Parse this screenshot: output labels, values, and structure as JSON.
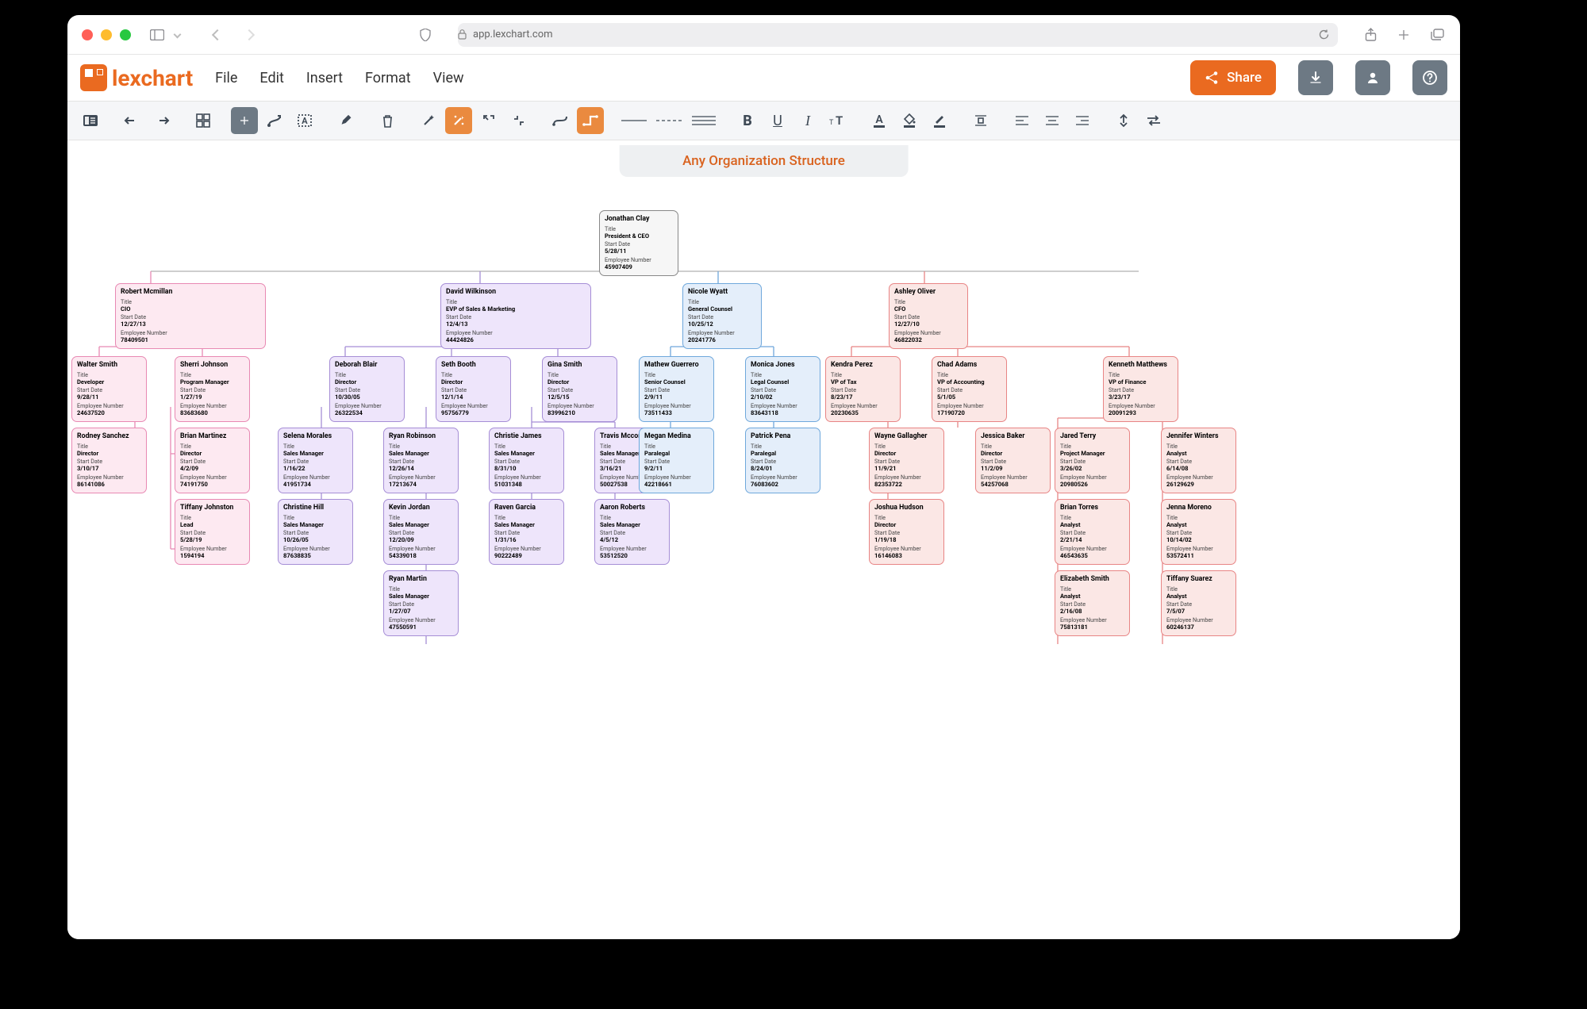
{
  "browser": {
    "url_host": "app.lexchart.com"
  },
  "brand": {
    "name": "lexchart"
  },
  "menu": {
    "file": "File",
    "edit": "Edit",
    "insert": "Insert",
    "format": "Format",
    "view": "View"
  },
  "header_buttons": {
    "share": "Share"
  },
  "chart_title": "Any Organization Structure",
  "field_labels": {
    "title": "Title",
    "start": "Start Date",
    "emp": "Employee Number"
  },
  "nodes": {
    "root": {
      "name": "Jonathan Clay",
      "title": "President & CEO",
      "start": "5/28/11",
      "emp": "45907409"
    },
    "l1a": {
      "name": "Robert Mcmillan",
      "title": "CIO",
      "start": "12/27/13",
      "emp": "78409501"
    },
    "l1b": {
      "name": "David Wilkinson",
      "title": "EVP of Sales & Marketing",
      "start": "12/4/13",
      "emp": "44424826"
    },
    "l1c": {
      "name": "Nicole Wyatt",
      "title": "General Counsel",
      "start": "10/25/12",
      "emp": "20241776"
    },
    "l1d": {
      "name": "Ashley Oliver",
      "title": "CFO",
      "start": "12/27/10",
      "emp": "46822032"
    },
    "a1": {
      "name": "Walter Smith",
      "title": "Developer",
      "start": "9/28/11",
      "emp": "24637520"
    },
    "a2": {
      "name": "Sherri Johnson",
      "title": "Program Manager",
      "start": "1/27/19",
      "emp": "83683680"
    },
    "a3": {
      "name": "Rodney Sanchez",
      "title": "Director",
      "start": "3/10/17",
      "emp": "86141086"
    },
    "a4": {
      "name": "Brian Martinez",
      "title": "Director",
      "start": "4/2/09",
      "emp": "74191750"
    },
    "a5": {
      "name": "Tiffany Johnston",
      "title": "Lead",
      "start": "5/28/19",
      "emp": "1594194"
    },
    "b1": {
      "name": "Deborah Blair",
      "title": "Director",
      "start": "10/30/05",
      "emp": "26322534"
    },
    "b2": {
      "name": "Seth Booth",
      "title": "Director",
      "start": "12/1/14",
      "emp": "95756779"
    },
    "b3": {
      "name": "Gina Smith",
      "title": "Director",
      "start": "12/5/15",
      "emp": "83996210"
    },
    "b1a": {
      "name": "Selena Morales",
      "title": "Sales Manager",
      "start": "1/16/22",
      "emp": "41951734"
    },
    "b1b": {
      "name": "Christine Hill",
      "title": "Sales Manager",
      "start": "10/26/05",
      "emp": "87638835"
    },
    "b2a": {
      "name": "Ryan Robinson",
      "title": "Sales Manager",
      "start": "12/26/14",
      "emp": "17213674"
    },
    "b2b": {
      "name": "Kevin Jordan",
      "title": "Sales Manager",
      "start": "12/20/09",
      "emp": "54339018"
    },
    "b2c": {
      "name": "Ryan Martin",
      "title": "Sales Manager",
      "start": "1/27/07",
      "emp": "47550591"
    },
    "b3a": {
      "name": "Christie James",
      "title": "Sales Manager",
      "start": "8/31/10",
      "emp": "51031348"
    },
    "b3b": {
      "name": "Raven Garcia",
      "title": "Sales Manager",
      "start": "1/31/16",
      "emp": "90222489"
    },
    "b3c": {
      "name": "Travis Mccormick",
      "title": "Sales Manager",
      "start": "3/16/21",
      "emp": "50027538"
    },
    "b3d": {
      "name": "Aaron Roberts",
      "title": "Sales Manager",
      "start": "4/5/12",
      "emp": "53512520"
    },
    "c1": {
      "name": "Mathew Guerrero",
      "title": "Senior Counsel",
      "start": "2/9/11",
      "emp": "73511433"
    },
    "c2": {
      "name": "Monica Jones",
      "title": "Legal Counsel",
      "start": "2/10/02",
      "emp": "83643118"
    },
    "c1a": {
      "name": "Megan Medina",
      "title": "Paralegal",
      "start": "9/2/11",
      "emp": "42218661"
    },
    "c2a": {
      "name": "Patrick Pena",
      "title": "Paralegal",
      "start": "8/24/01",
      "emp": "76083602"
    },
    "d1": {
      "name": "Kendra Perez",
      "title": "VP of Tax",
      "start": "8/23/17",
      "emp": "20230635"
    },
    "d2": {
      "name": "Chad Adams",
      "title": "VP of Accounting",
      "start": "5/1/05",
      "emp": "17190720"
    },
    "d3": {
      "name": "Kenneth Matthews",
      "title": "VP of Finance",
      "start": "3/23/17",
      "emp": "20091293"
    },
    "d1a": {
      "name": "Wayne Gallagher",
      "title": "Director",
      "start": "11/9/21",
      "emp": "82353722"
    },
    "d1b": {
      "name": "Joshua Hudson",
      "title": "Director",
      "start": "1/19/18",
      "emp": "16146083"
    },
    "d2a": {
      "name": "Jessica Baker",
      "title": "Director",
      "start": "11/2/09",
      "emp": "54257068"
    },
    "d3a": {
      "name": "Jared Terry",
      "title": "Project Manager",
      "start": "3/26/02",
      "emp": "20980526"
    },
    "d3b": {
      "name": "Brian Torres",
      "title": "Analyst",
      "start": "2/21/14",
      "emp": "46543635"
    },
    "d3c": {
      "name": "Elizabeth Smith",
      "title": "Analyst",
      "start": "2/16/08",
      "emp": "75813181"
    },
    "d3d": {
      "name": "Jennifer Winters",
      "title": "Analyst",
      "start": "6/14/08",
      "emp": "26129629"
    },
    "d3e": {
      "name": "Jenna Moreno",
      "title": "Analyst",
      "start": "10/14/02",
      "emp": "53572411"
    },
    "d3f": {
      "name": "Tiffany Suarez",
      "title": "Analyst",
      "start": "7/5/07",
      "emp": "60246137"
    }
  }
}
